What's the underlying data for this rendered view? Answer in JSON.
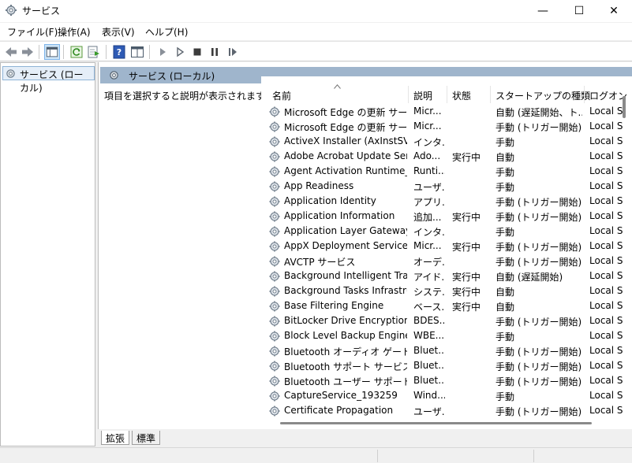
{
  "window": {
    "title": "サービス",
    "minimize_glyph": "—",
    "maximize_glyph": "☐",
    "close_glyph": "✕"
  },
  "menu": [
    {
      "label": "ファイル(F)"
    },
    {
      "label": "操作(A)"
    },
    {
      "label": "表示(V)"
    },
    {
      "label": "ヘルプ(H)"
    }
  ],
  "toolbar_icons": [
    "back-arrow-icon",
    "forward-arrow-icon",
    "show-hide-console-tree-icon",
    "refresh-icon",
    "export-list-icon",
    "help-icon",
    "properties-icon",
    "start-service-icon",
    "start-service-alt-icon",
    "stop-service-icon",
    "pause-service-icon",
    "resume-service-icon"
  ],
  "tree": {
    "node_label": "サービス (ローカル)"
  },
  "pane": {
    "header": "サービス (ローカル)",
    "description": "項目を選択すると説明が表示されます。"
  },
  "columns": {
    "name": "名前",
    "description": "説明",
    "status": "状態",
    "startup_type": "スタートアップの種類",
    "logon_as": "ログオン"
  },
  "services": [
    {
      "name": "Microsoft Edge の更新 サー...",
      "desc": "Micr...",
      "status": "",
      "startup": "自動 (遅延開始、ト...",
      "logon": "Local S"
    },
    {
      "name": "Microsoft Edge の更新 サー...",
      "desc": "Micr...",
      "status": "",
      "startup": "手動 (トリガー開始)",
      "logon": "Local S"
    },
    {
      "name": "ActiveX Installer (AxInstSV)",
      "desc": "インタ...",
      "status": "",
      "startup": "手動",
      "logon": "Local S"
    },
    {
      "name": "Adobe Acrobat Update Serv...",
      "desc": "Ado...",
      "status": "実行中",
      "startup": "自動",
      "logon": "Local S"
    },
    {
      "name": "Agent Activation Runtime_1...",
      "desc": "Runti...",
      "status": "",
      "startup": "手動",
      "logon": "Local S"
    },
    {
      "name": "App Readiness",
      "desc": "ユーザ...",
      "status": "",
      "startup": "手動",
      "logon": "Local S"
    },
    {
      "name": "Application Identity",
      "desc": "アプリ...",
      "status": "",
      "startup": "手動 (トリガー開始)",
      "logon": "Local S"
    },
    {
      "name": "Application Information",
      "desc": "追加...",
      "status": "実行中",
      "startup": "手動 (トリガー開始)",
      "logon": "Local S"
    },
    {
      "name": "Application Layer Gateway ...",
      "desc": "インタ...",
      "status": "",
      "startup": "手動",
      "logon": "Local S"
    },
    {
      "name": "AppX Deployment Service (...",
      "desc": "Micr...",
      "status": "実行中",
      "startup": "手動 (トリガー開始)",
      "logon": "Local S"
    },
    {
      "name": "AVCTP サービス",
      "desc": "オーデ...",
      "status": "",
      "startup": "手動 (トリガー開始)",
      "logon": "Local S"
    },
    {
      "name": "Background Intelligent Tran...",
      "desc": "アイド...",
      "status": "実行中",
      "startup": "自動 (遅延開始)",
      "logon": "Local S"
    },
    {
      "name": "Background Tasks Infrastruc...",
      "desc": "システ...",
      "status": "実行中",
      "startup": "自動",
      "logon": "Local S"
    },
    {
      "name": "Base Filtering Engine",
      "desc": "ベース...",
      "status": "実行中",
      "startup": "自動",
      "logon": "Local S"
    },
    {
      "name": "BitLocker Drive Encryption ...",
      "desc": "BDES...",
      "status": "",
      "startup": "手動 (トリガー開始)",
      "logon": "Local S"
    },
    {
      "name": "Block Level Backup Engine ...",
      "desc": "WBE...",
      "status": "",
      "startup": "手動",
      "logon": "Local S"
    },
    {
      "name": "Bluetooth オーディオ ゲートウェ...",
      "desc": "Bluet...",
      "status": "",
      "startup": "手動 (トリガー開始)",
      "logon": "Local S"
    },
    {
      "name": "Bluetooth サポート サービス",
      "desc": "Bluet...",
      "status": "",
      "startup": "手動 (トリガー開始)",
      "logon": "Local S"
    },
    {
      "name": "Bluetooth ユーザー サポート サ...",
      "desc": "Bluet...",
      "status": "",
      "startup": "手動 (トリガー開始)",
      "logon": "Local S"
    },
    {
      "name": "CaptureService_193259",
      "desc": "Wind...",
      "status": "",
      "startup": "手動",
      "logon": "Local S"
    },
    {
      "name": "Certificate Propagation",
      "desc": "ユーザ...",
      "status": "",
      "startup": "手動 (トリガー開始)",
      "logon": "Local S"
    }
  ],
  "tabs": [
    {
      "label": "拡張"
    },
    {
      "label": "標準"
    }
  ]
}
